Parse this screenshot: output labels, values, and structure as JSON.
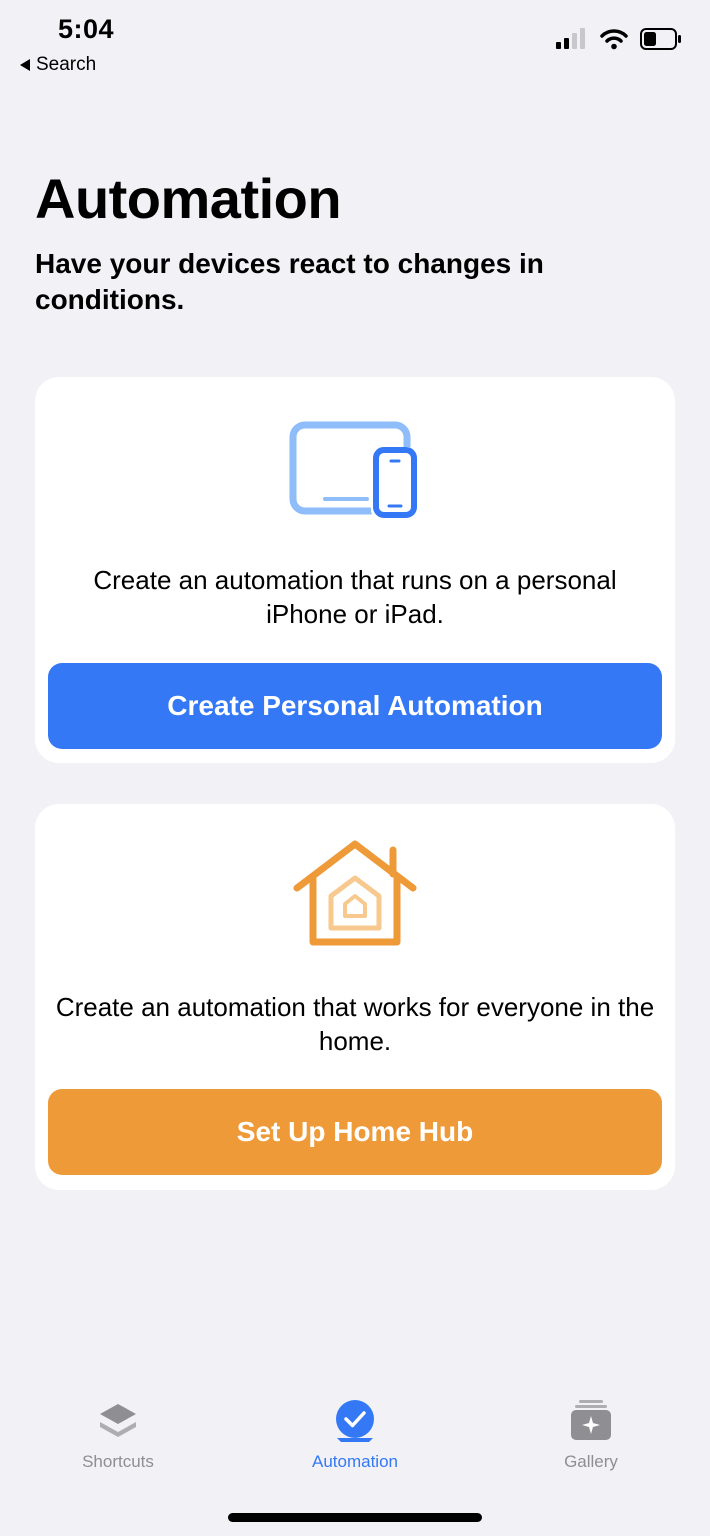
{
  "status_bar": {
    "time": "5:04",
    "back_label": "Search"
  },
  "page": {
    "title": "Automation",
    "subtitle": "Have your devices react to changes in conditions."
  },
  "cards": {
    "personal": {
      "icon": "devices-icon",
      "description": "Create an automation that runs on a personal iPhone or iPad.",
      "button_label": "Create Personal Automation",
      "button_color": "#3478f6"
    },
    "home": {
      "icon": "home-icon",
      "description": "Create an automation that works for everyone in the home.",
      "button_label": "Set Up Home Hub",
      "button_color": "#ef9a38"
    }
  },
  "tab_bar": {
    "tabs": [
      {
        "label": "Shortcuts",
        "icon": "stack-icon",
        "active": false
      },
      {
        "label": "Automation",
        "icon": "automation-check-icon",
        "active": true
      },
      {
        "label": "Gallery",
        "icon": "gallery-icon",
        "active": false
      }
    ],
    "active_color": "#3478f6",
    "inactive_color": "#8e8e93"
  }
}
